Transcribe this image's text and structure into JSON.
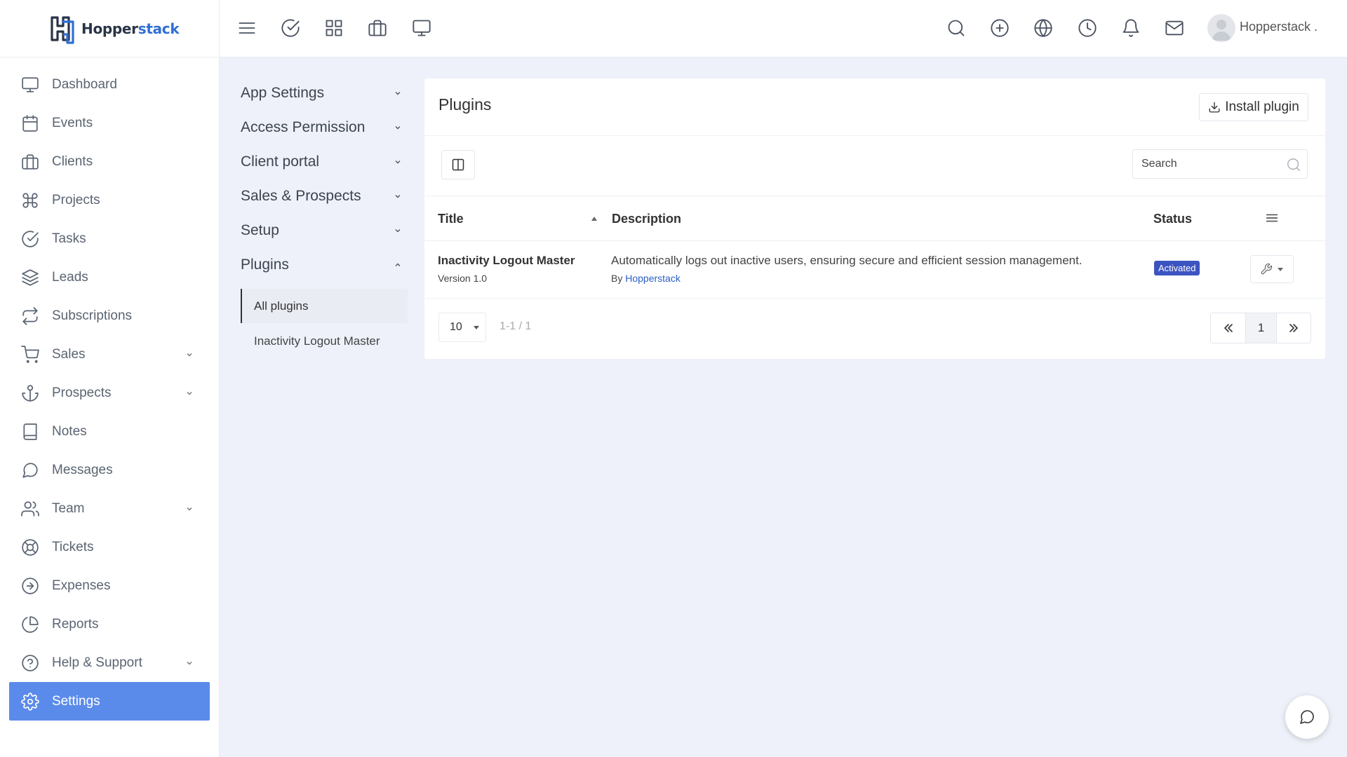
{
  "brand": {
    "name_part1": "Hopper",
    "name_part2": "stack"
  },
  "sidebar": {
    "items": [
      {
        "label": "Dashboard",
        "icon": "monitor-icon"
      },
      {
        "label": "Events",
        "icon": "calendar-icon"
      },
      {
        "label": "Clients",
        "icon": "briefcase-icon"
      },
      {
        "label": "Projects",
        "icon": "command-icon"
      },
      {
        "label": "Tasks",
        "icon": "check-circle-icon"
      },
      {
        "label": "Leads",
        "icon": "layers-icon"
      },
      {
        "label": "Subscriptions",
        "icon": "repeat-icon"
      },
      {
        "label": "Sales",
        "icon": "shopping-cart-icon",
        "has_submenu": true
      },
      {
        "label": "Prospects",
        "icon": "anchor-icon",
        "has_submenu": true
      },
      {
        "label": "Notes",
        "icon": "book-icon"
      },
      {
        "label": "Messages",
        "icon": "message-circle-icon"
      },
      {
        "label": "Team",
        "icon": "users-icon",
        "has_submenu": true
      },
      {
        "label": "Tickets",
        "icon": "life-buoy-icon"
      },
      {
        "label": "Expenses",
        "icon": "arrow-right-circle-icon"
      },
      {
        "label": "Reports",
        "icon": "pie-chart-icon"
      },
      {
        "label": "Help & Support",
        "icon": "help-circle-icon",
        "has_submenu": true
      },
      {
        "label": "Settings",
        "icon": "settings-icon",
        "active": true
      }
    ]
  },
  "topbar": {
    "left_icons": [
      "menu-icon",
      "check-circle-icon",
      "grid-icon",
      "briefcase-icon",
      "monitor-icon"
    ],
    "right_icons": [
      "search-icon",
      "plus-circle-icon",
      "globe-icon",
      "clock-icon",
      "bell-icon",
      "mail-icon"
    ],
    "user_name": "Hopperstack ."
  },
  "settings_nav": {
    "groups": [
      {
        "label": "App Settings",
        "expanded": false
      },
      {
        "label": "Access Permission",
        "expanded": false
      },
      {
        "label": "Client portal",
        "expanded": false
      },
      {
        "label": "Sales & Prospects",
        "expanded": false
      },
      {
        "label": "Setup",
        "expanded": false
      },
      {
        "label": "Plugins",
        "expanded": true
      }
    ],
    "plugins_sub": [
      {
        "label": "All plugins",
        "active": true
      },
      {
        "label": "Inactivity Logout Master",
        "active": false
      }
    ]
  },
  "plugins_page": {
    "title": "Plugins",
    "install_label": "Install plugin",
    "search_placeholder": "Search",
    "columns": {
      "title": "Title",
      "description": "Description",
      "status": "Status"
    },
    "rows": [
      {
        "title": "Inactivity Logout Master",
        "version": "Version 1.0",
        "description": "Automatically logs out inactive users, ensuring secure and efficient session management.",
        "by_prefix": "By",
        "author": "Hopperstack",
        "status": "Activated"
      }
    ],
    "page_size": "10",
    "page_info": "1-1 / 1",
    "current_page": "1"
  },
  "colors": {
    "accent": "#5b8bea",
    "status_activated": "#3c54c2",
    "link": "#2a5ec4",
    "brand_dark": "#2a3446",
    "brand_blue": "#2f6fd4"
  }
}
